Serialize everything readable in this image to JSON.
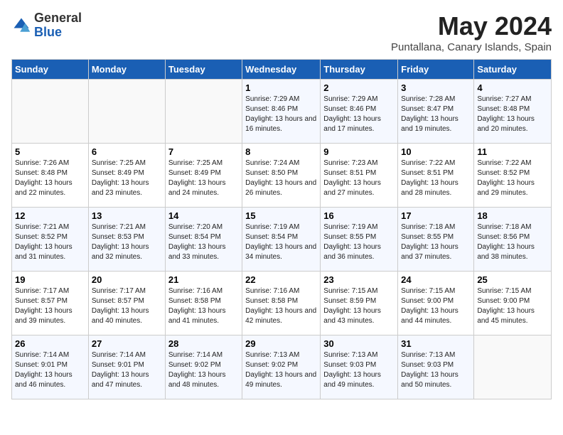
{
  "header": {
    "logo_general": "General",
    "logo_blue": "Blue",
    "month_year": "May 2024",
    "location": "Puntallana, Canary Islands, Spain"
  },
  "days_of_week": [
    "Sunday",
    "Monday",
    "Tuesday",
    "Wednesday",
    "Thursday",
    "Friday",
    "Saturday"
  ],
  "weeks": [
    [
      {
        "day": "",
        "info": ""
      },
      {
        "day": "",
        "info": ""
      },
      {
        "day": "",
        "info": ""
      },
      {
        "day": "1",
        "info": "Sunrise: 7:29 AM\nSunset: 8:46 PM\nDaylight: 13 hours and 16 minutes."
      },
      {
        "day": "2",
        "info": "Sunrise: 7:29 AM\nSunset: 8:46 PM\nDaylight: 13 hours and 17 minutes."
      },
      {
        "day": "3",
        "info": "Sunrise: 7:28 AM\nSunset: 8:47 PM\nDaylight: 13 hours and 19 minutes."
      },
      {
        "day": "4",
        "info": "Sunrise: 7:27 AM\nSunset: 8:48 PM\nDaylight: 13 hours and 20 minutes."
      }
    ],
    [
      {
        "day": "5",
        "info": "Sunrise: 7:26 AM\nSunset: 8:48 PM\nDaylight: 13 hours and 22 minutes."
      },
      {
        "day": "6",
        "info": "Sunrise: 7:25 AM\nSunset: 8:49 PM\nDaylight: 13 hours and 23 minutes."
      },
      {
        "day": "7",
        "info": "Sunrise: 7:25 AM\nSunset: 8:49 PM\nDaylight: 13 hours and 24 minutes."
      },
      {
        "day": "8",
        "info": "Sunrise: 7:24 AM\nSunset: 8:50 PM\nDaylight: 13 hours and 26 minutes."
      },
      {
        "day": "9",
        "info": "Sunrise: 7:23 AM\nSunset: 8:51 PM\nDaylight: 13 hours and 27 minutes."
      },
      {
        "day": "10",
        "info": "Sunrise: 7:22 AM\nSunset: 8:51 PM\nDaylight: 13 hours and 28 minutes."
      },
      {
        "day": "11",
        "info": "Sunrise: 7:22 AM\nSunset: 8:52 PM\nDaylight: 13 hours and 29 minutes."
      }
    ],
    [
      {
        "day": "12",
        "info": "Sunrise: 7:21 AM\nSunset: 8:52 PM\nDaylight: 13 hours and 31 minutes."
      },
      {
        "day": "13",
        "info": "Sunrise: 7:21 AM\nSunset: 8:53 PM\nDaylight: 13 hours and 32 minutes."
      },
      {
        "day": "14",
        "info": "Sunrise: 7:20 AM\nSunset: 8:54 PM\nDaylight: 13 hours and 33 minutes."
      },
      {
        "day": "15",
        "info": "Sunrise: 7:19 AM\nSunset: 8:54 PM\nDaylight: 13 hours and 34 minutes."
      },
      {
        "day": "16",
        "info": "Sunrise: 7:19 AM\nSunset: 8:55 PM\nDaylight: 13 hours and 36 minutes."
      },
      {
        "day": "17",
        "info": "Sunrise: 7:18 AM\nSunset: 8:55 PM\nDaylight: 13 hours and 37 minutes."
      },
      {
        "day": "18",
        "info": "Sunrise: 7:18 AM\nSunset: 8:56 PM\nDaylight: 13 hours and 38 minutes."
      }
    ],
    [
      {
        "day": "19",
        "info": "Sunrise: 7:17 AM\nSunset: 8:57 PM\nDaylight: 13 hours and 39 minutes."
      },
      {
        "day": "20",
        "info": "Sunrise: 7:17 AM\nSunset: 8:57 PM\nDaylight: 13 hours and 40 minutes."
      },
      {
        "day": "21",
        "info": "Sunrise: 7:16 AM\nSunset: 8:58 PM\nDaylight: 13 hours and 41 minutes."
      },
      {
        "day": "22",
        "info": "Sunrise: 7:16 AM\nSunset: 8:58 PM\nDaylight: 13 hours and 42 minutes."
      },
      {
        "day": "23",
        "info": "Sunrise: 7:15 AM\nSunset: 8:59 PM\nDaylight: 13 hours and 43 minutes."
      },
      {
        "day": "24",
        "info": "Sunrise: 7:15 AM\nSunset: 9:00 PM\nDaylight: 13 hours and 44 minutes."
      },
      {
        "day": "25",
        "info": "Sunrise: 7:15 AM\nSunset: 9:00 PM\nDaylight: 13 hours and 45 minutes."
      }
    ],
    [
      {
        "day": "26",
        "info": "Sunrise: 7:14 AM\nSunset: 9:01 PM\nDaylight: 13 hours and 46 minutes."
      },
      {
        "day": "27",
        "info": "Sunrise: 7:14 AM\nSunset: 9:01 PM\nDaylight: 13 hours and 47 minutes."
      },
      {
        "day": "28",
        "info": "Sunrise: 7:14 AM\nSunset: 9:02 PM\nDaylight: 13 hours and 48 minutes."
      },
      {
        "day": "29",
        "info": "Sunrise: 7:13 AM\nSunset: 9:02 PM\nDaylight: 13 hours and 49 minutes."
      },
      {
        "day": "30",
        "info": "Sunrise: 7:13 AM\nSunset: 9:03 PM\nDaylight: 13 hours and 49 minutes."
      },
      {
        "day": "31",
        "info": "Sunrise: 7:13 AM\nSunset: 9:03 PM\nDaylight: 13 hours and 50 minutes."
      },
      {
        "day": "",
        "info": ""
      }
    ]
  ],
  "colors": {
    "header_bg": "#1a5fb4",
    "header_text": "#ffffff",
    "logo_blue": "#1a5fb4"
  }
}
